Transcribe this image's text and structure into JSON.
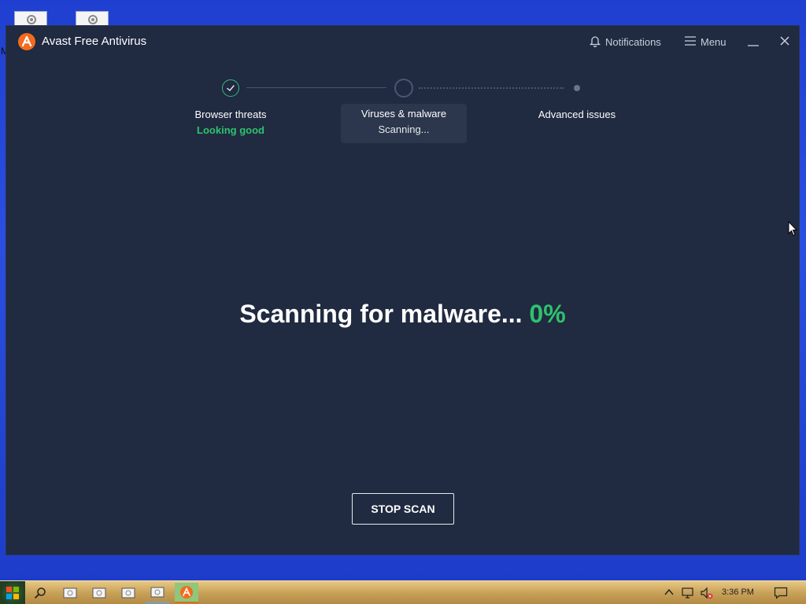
{
  "app": {
    "title": "Avast Free Antivirus",
    "notifications_label": "Notifications",
    "menu_label": "Menu"
  },
  "steps": [
    {
      "name": "Browser threats",
      "status": "Looking good",
      "state": "done"
    },
    {
      "name": "Viruses & malware",
      "status": "Scanning...",
      "state": "active"
    },
    {
      "name": "Advanced issues",
      "status": "",
      "state": "pending"
    }
  ],
  "scan": {
    "headline": "Scanning for malware...",
    "percent_label": "0%",
    "progress": 0,
    "stop_label": "STOP SCAN"
  },
  "desktop": {
    "partial_letter": "M"
  },
  "taskbar": {
    "clock": "3:36 PM",
    "items": [
      "search-icon",
      "window-icon",
      "window-icon",
      "window-icon",
      "window-icon",
      "avast-icon"
    ]
  },
  "colors": {
    "window_bg": "#202a40",
    "accent_green": "#2ec26e",
    "avast_orange": "#f46b1d"
  }
}
